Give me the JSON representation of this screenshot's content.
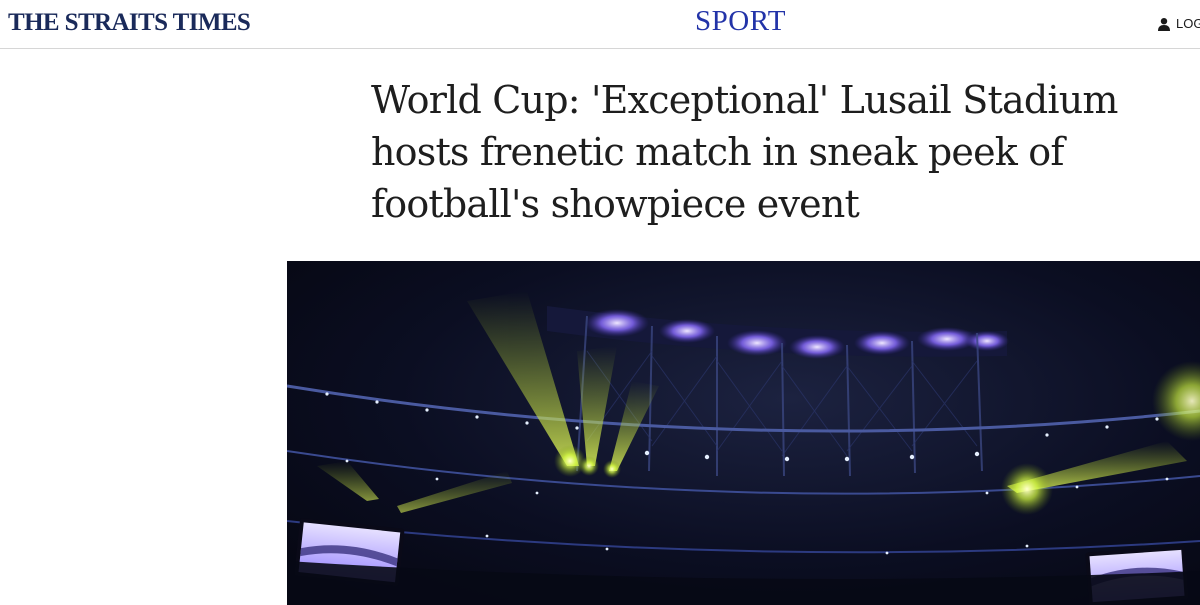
{
  "header": {
    "logo_text": "THE STRAITS TIMES",
    "section_label": "SPORT",
    "login_label": "LOG"
  },
  "article": {
    "headline": "World Cup: 'Exceptional' Lusail Stadium hosts frenetic match in sneak peek of football's showpiece event"
  },
  "hero_image": {
    "subject": "stadium-lights-photo"
  },
  "colors": {
    "logo": "#1a2a5a",
    "section": "#2233a8",
    "headline": "#1e1e1e"
  }
}
